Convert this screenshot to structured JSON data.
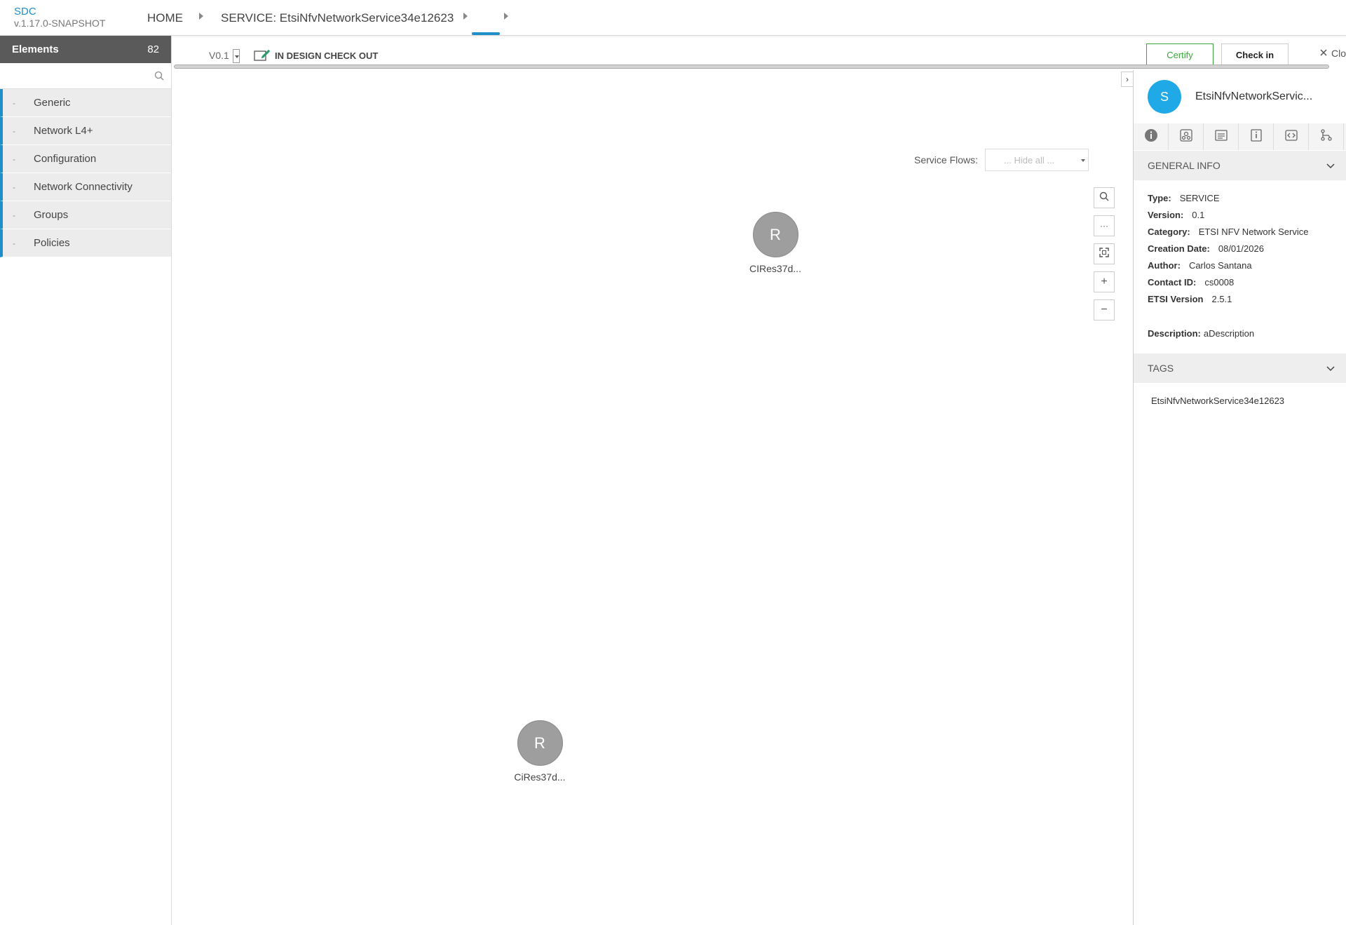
{
  "app": {
    "brand": "SDC",
    "version": "v.1.17.0-SNAPSHOT"
  },
  "breadcrumb": {
    "home": "HOME",
    "service": "SERVICE: EtsiNfvNetworkService34e12623"
  },
  "palette": {
    "title": "Elements",
    "count": "82",
    "search_placeholder": "",
    "categories": [
      {
        "label": "Generic"
      },
      {
        "label": "Network L4+"
      },
      {
        "label": "Configuration"
      },
      {
        "label": "Network Connectivity"
      },
      {
        "label": "Groups"
      },
      {
        "label": "Policies"
      }
    ]
  },
  "toolbar": {
    "version": "V0.1",
    "status": "IN DESIGN CHECK OUT",
    "certify": "Certify",
    "checkin": "Check in",
    "close": "Clo"
  },
  "canvas": {
    "flows_label": "Service Flows:",
    "flows_value": "... Hide all ...",
    "nodes": [
      {
        "letter": "R",
        "label": "CIRes37d..."
      },
      {
        "letter": "R",
        "label": "CiRes37d..."
      }
    ]
  },
  "details": {
    "avatar_letter": "S",
    "name": "EtsiNfvNetworkServic...",
    "general_info_title": "GENERAL INFO",
    "fields": [
      {
        "key": "Type:",
        "value": "SERVICE"
      },
      {
        "key": "Version:",
        "value": "0.1"
      },
      {
        "key": "Category:",
        "value": "ETSI NFV Network Service"
      },
      {
        "key": "Creation Date:",
        "value": "08/01/2026"
      },
      {
        "key": "Author:",
        "value": "Carlos Santana"
      },
      {
        "key": "Contact ID:",
        "value": "cs0008"
      },
      {
        "key": "ETSI Version",
        "value": "2.5.1"
      }
    ],
    "description_key": "Description:",
    "description_value": "aDescription",
    "tags_title": "TAGS",
    "tag": "EtsiNfvNetworkService34e12623"
  },
  "colors": {
    "accent": "#1f8fc9",
    "certify": "#3aa63a",
    "avatar": "#1fa9e6",
    "node": "#9e9e9e",
    "palette_header": "#5a5a5a"
  }
}
